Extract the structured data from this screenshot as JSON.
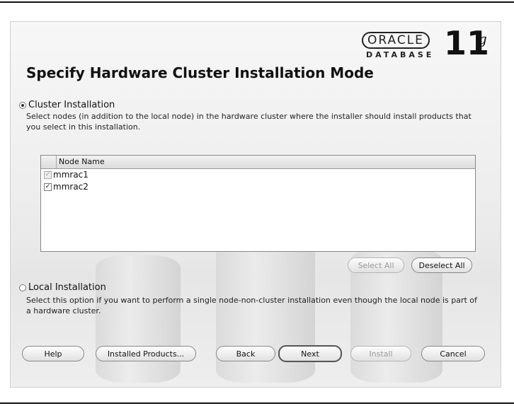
{
  "logo": {
    "brand": "ORACLE",
    "sub": "DATABASE",
    "version": "11",
    "suffix": "g"
  },
  "title": "Specify Hardware Cluster Installation Mode",
  "cluster_option": {
    "label": "Cluster Installation",
    "selected": true,
    "description": "Select nodes (in addition to the local node) in the hardware cluster where the installer should install products that you select in this installation."
  },
  "node_table": {
    "column": "Node Name",
    "rows": [
      {
        "name": "mmrac1",
        "checked": true,
        "enabled": false
      },
      {
        "name": "mmrac2",
        "checked": true,
        "enabled": true
      }
    ]
  },
  "table_buttons": {
    "select_all": "Select All",
    "deselect_all": "Deselect All"
  },
  "local_option": {
    "label": "Local Installation",
    "selected": false,
    "description": "Select this option if you want to perform a single node-non-cluster installation even though the local node is part of a hardware cluster."
  },
  "footer": {
    "help": "Help",
    "installed_products": "Installed Products...",
    "back": "Back",
    "next": "Next",
    "install": "Install",
    "cancel": "Cancel"
  }
}
